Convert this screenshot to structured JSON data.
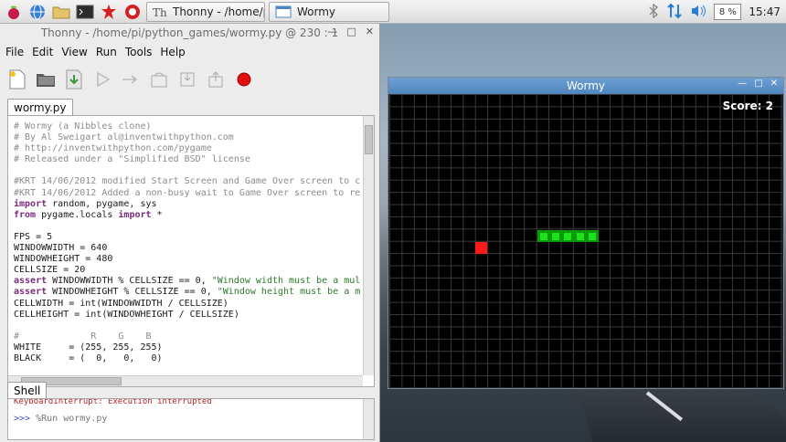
{
  "taskbar": {
    "launcher_icons": [
      "raspberry-menu-icon",
      "web-browser-icon",
      "file-manager-icon",
      "terminal-icon",
      "math-icon",
      "wolfram-icon"
    ],
    "tasks": [
      {
        "label": "Thonny  -  /home/pi/..."
      },
      {
        "label": "Wormy"
      }
    ],
    "cpu_usage": "8 %",
    "clock": "15:47"
  },
  "thonny": {
    "title": "Thonny  -  /home/pi/python_games/wormy.py  @  230 : 1",
    "menu": [
      "File",
      "Edit",
      "View",
      "Run",
      "Tools",
      "Help"
    ],
    "tab_label": "wormy.py",
    "code_lines": [
      {
        "t": "c",
        "v": "# Wormy (a Nibbles clone)"
      },
      {
        "t": "c",
        "v": "# By Al Sweigart al@inventwithpython.com"
      },
      {
        "t": "c",
        "v": "# http://inventwithpython.com/pygame"
      },
      {
        "t": "c",
        "v": "# Released under a \"Simplified BSD\" license"
      },
      {
        "t": "p",
        "v": ""
      },
      {
        "t": "c",
        "v": "#KRT 14/06/2012 modified Start Screen and Game Over screen to c"
      },
      {
        "t": "c",
        "v": "#KRT 14/06/2012 Added a non-busy wait to Game Over screen to re"
      },
      {
        "t": "kw",
        "k": "import",
        "v": " random, pygame, sys"
      },
      {
        "t": "kw2",
        "k": "from",
        "v": " pygame.locals ",
        "k2": "import",
        "v2": " *"
      },
      {
        "t": "p",
        "v": ""
      },
      {
        "t": "p",
        "v": "FPS = 5"
      },
      {
        "t": "p",
        "v": "WINDOWWIDTH = 640"
      },
      {
        "t": "p",
        "v": "WINDOWHEIGHT = 480"
      },
      {
        "t": "p",
        "v": "CELLSIZE = 20"
      },
      {
        "t": "as",
        "k": "assert",
        "v": " WINDOWWIDTH % CELLSIZE == 0, ",
        "s": "\"Window width must be a mul"
      },
      {
        "t": "as",
        "k": "assert",
        "v": " WINDOWHEIGHT % CELLSIZE == 0, ",
        "s": "\"Window height must be a m"
      },
      {
        "t": "p",
        "v": "CELLWIDTH = int(WINDOWWIDTH / CELLSIZE)"
      },
      {
        "t": "p",
        "v": "CELLHEIGHT = int(WINDOWHEIGHT / CELLSIZE)"
      },
      {
        "t": "p",
        "v": ""
      },
      {
        "t": "c",
        "v": "#             R    G    B"
      },
      {
        "t": "p",
        "v": "WHITE     = (255, 255, 255)"
      },
      {
        "t": "p",
        "v": "BLACK     = (  0,   0,   0)"
      }
    ],
    "shell_tab": "Shell",
    "shell_error": "KeyboardInterrupt: Execution interrupted",
    "shell_prompt": ">>>",
    "shell_command": "%Run wormy.py"
  },
  "wormy": {
    "title": "Wormy",
    "score": "Score: 2",
    "worm_length": 5,
    "colors": {
      "worm_outer": "#0a9a0a",
      "worm_inner": "#1ee01e",
      "apple": "#ff1a1a",
      "grid": "#3a3a3a"
    }
  }
}
